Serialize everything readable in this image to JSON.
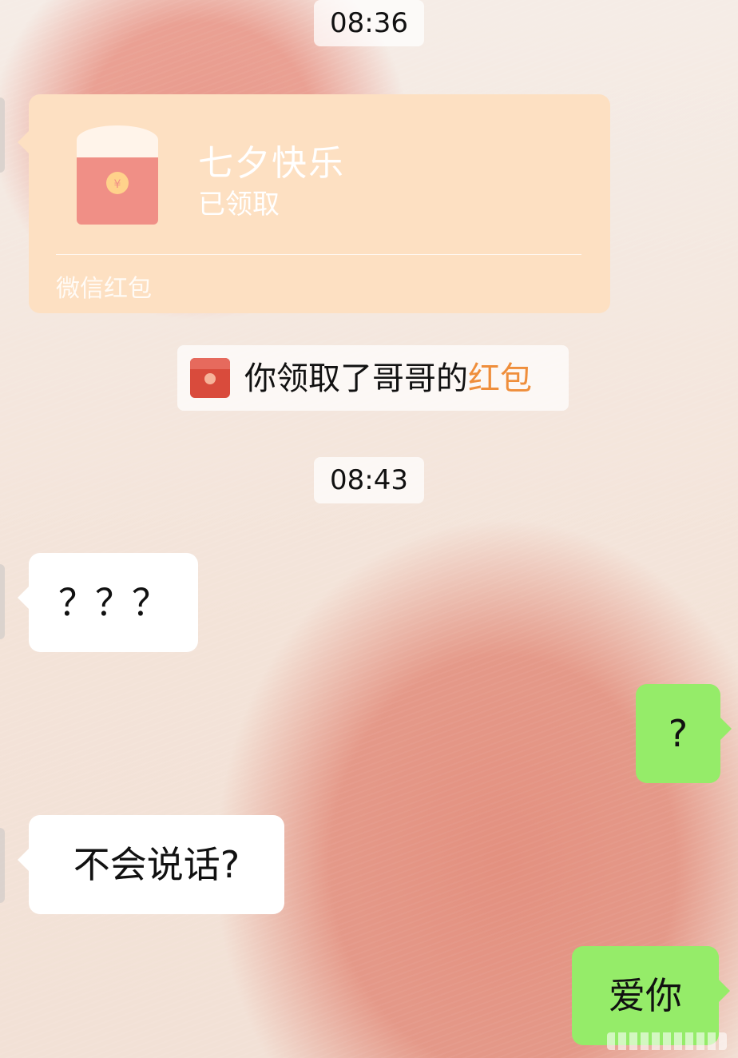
{
  "chat": {
    "timestamps": [
      "08:36",
      "08:43"
    ],
    "red_packet": {
      "title": "七夕快乐",
      "status": "已领取",
      "footer": "微信红包"
    },
    "system_notice": {
      "text_prefix": "你领取了哥哥的",
      "text_link": "红包",
      "link_color": "#ef8e3b"
    },
    "messages": [
      {
        "side": "left",
        "text": "？？？"
      },
      {
        "side": "right",
        "text": "?"
      },
      {
        "side": "left",
        "text": "不会说话?"
      },
      {
        "side": "right",
        "text": "爱你"
      }
    ]
  },
  "colors": {
    "packet_bg": "#fde0c2",
    "received_bubble": "#ffffff",
    "sent_bubble": "#95ec69"
  },
  "icons": {
    "red_packet_card_icon": "red-packet-icon",
    "notice_icon": "red-packet-icon-small"
  }
}
